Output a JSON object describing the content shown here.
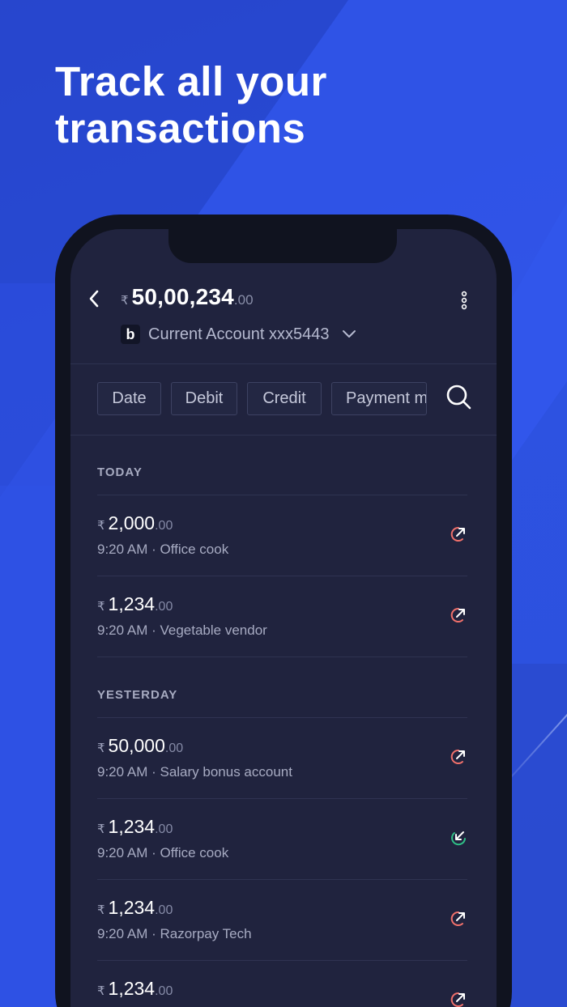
{
  "headline": {
    "line1": "Track all your",
    "line2": "transactions"
  },
  "header": {
    "back_icon": "chevron-left-icon",
    "currency_symbol": "₹",
    "balance_whole": "50,00,234",
    "balance_decimal": ".00",
    "bank_logo_text": "b",
    "account_name": "Current Account xxx5443",
    "more_icon": "vertical-dots-icon",
    "dropdown_icon": "chevron-down-icon"
  },
  "filters": [
    {
      "label": "Date"
    },
    {
      "label": "Debit"
    },
    {
      "label": "Credit"
    },
    {
      "label": "Payment m"
    }
  ],
  "search_icon": "search-icon",
  "sections": [
    {
      "label": "TODAY"
    },
    {
      "label": "YESTERDAY"
    }
  ],
  "transactions": [
    {
      "currency": "₹",
      "amount": "2,000",
      "decimal": ".00",
      "meta": "9:20 AM · Office cook",
      "direction": "debit"
    },
    {
      "currency": "₹",
      "amount": "1,234",
      "decimal": ".00",
      "meta": "9:20 AM · Vegetable vendor",
      "direction": "debit"
    },
    {
      "currency": "₹",
      "amount": "50,000",
      "decimal": ".00",
      "meta": "9:20 AM · Salary bonus account",
      "direction": "debit"
    },
    {
      "currency": "₹",
      "amount": "1,234",
      "decimal": ".00",
      "meta": "9:20 AM · Office cook",
      "direction": "credit"
    },
    {
      "currency": "₹",
      "amount": "1,234",
      "decimal": ".00",
      "meta": "9:20 AM · Razorpay Tech",
      "direction": "debit"
    },
    {
      "currency": "₹",
      "amount": "1,234",
      "decimal": ".00",
      "meta": "",
      "direction": "debit"
    }
  ],
  "colors": {
    "debit": "#f0706b",
    "credit": "#2fbf86",
    "screen_bg": "#20233e",
    "page_bg": "#2f55e6"
  }
}
